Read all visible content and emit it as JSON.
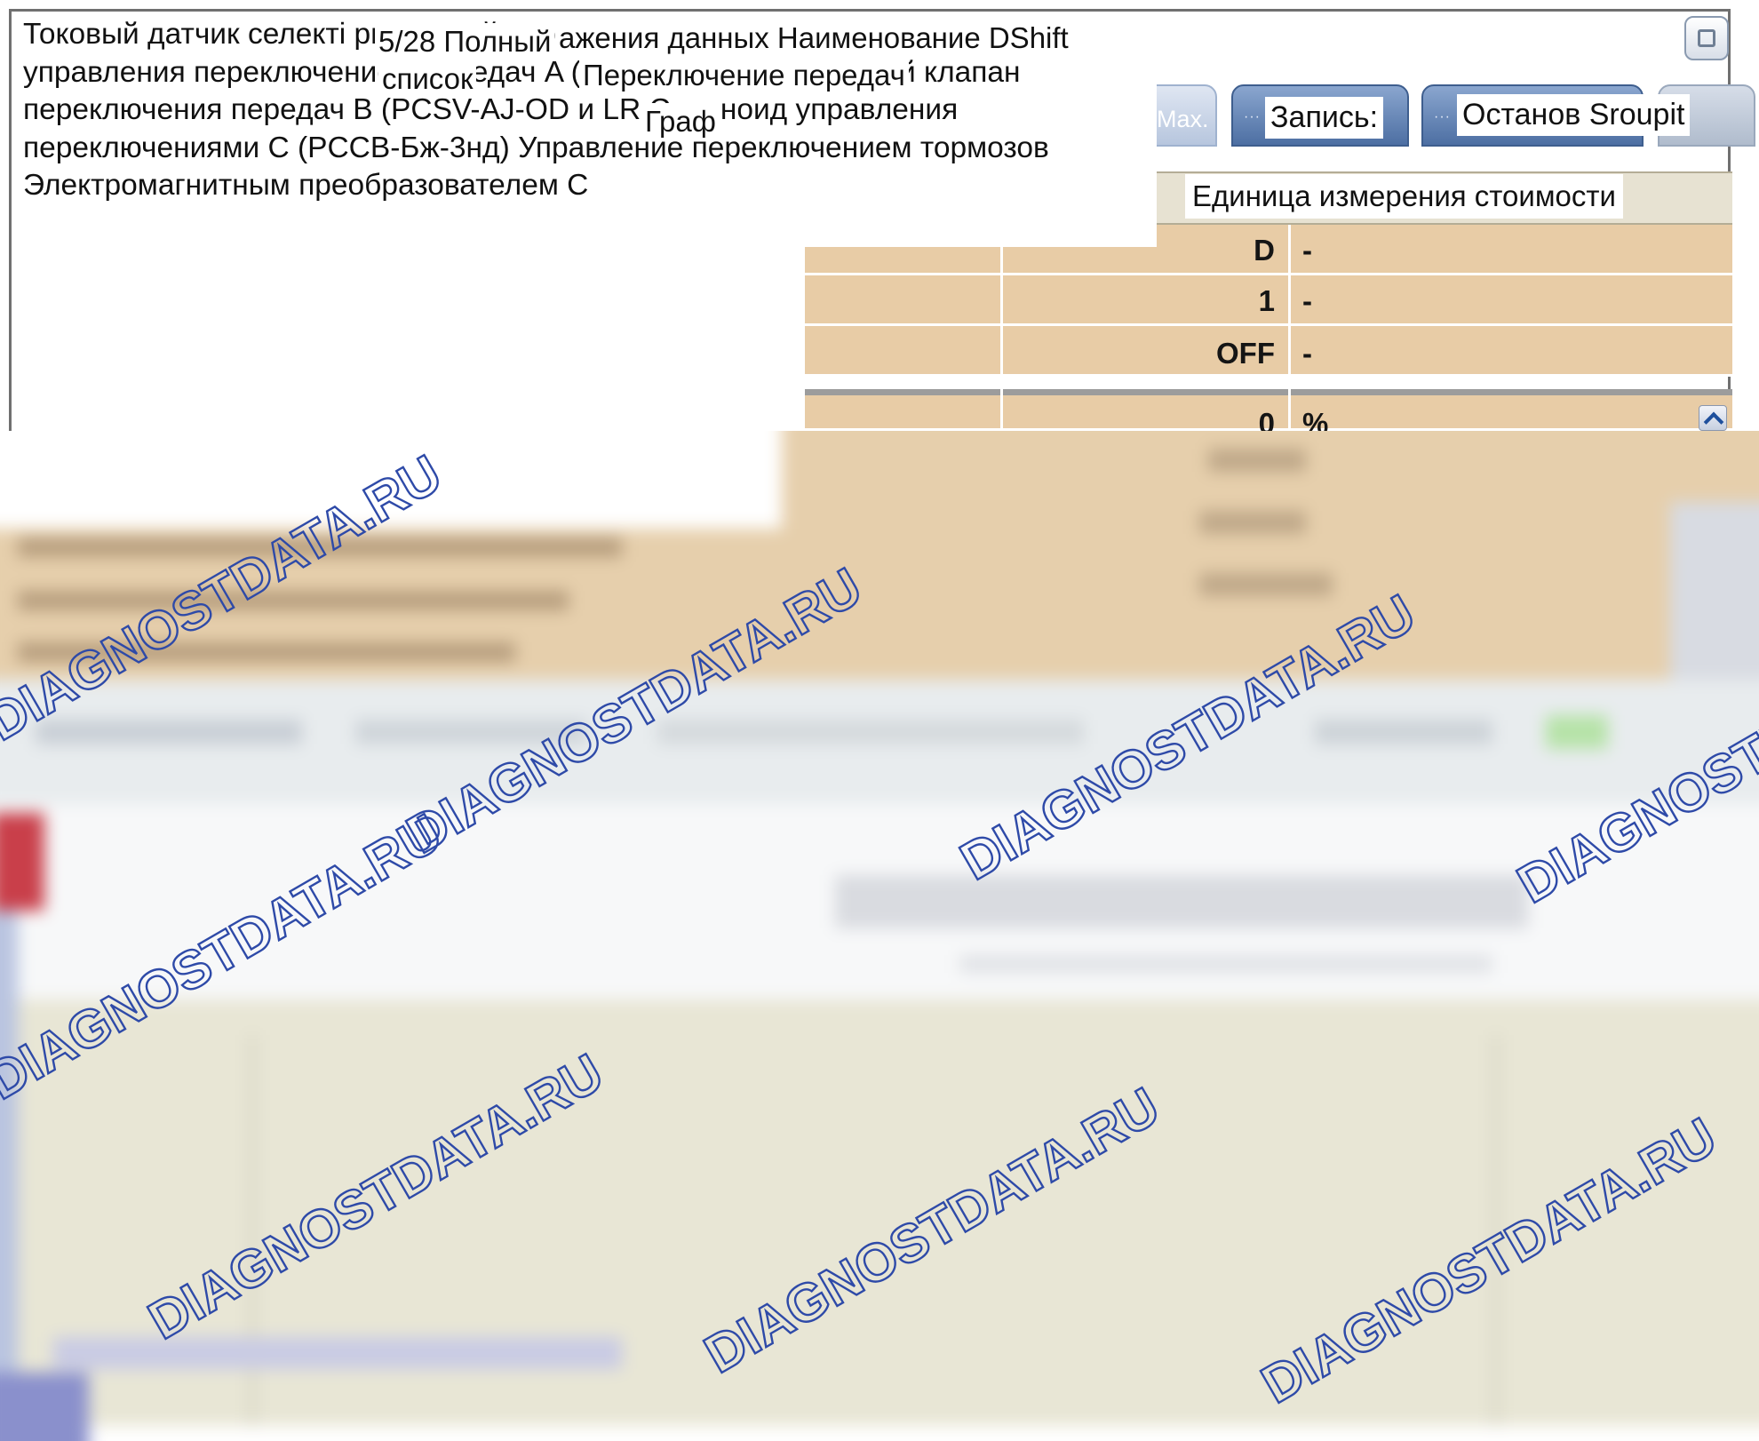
{
  "popup": {
    "description": "Токовый датчик селекті рычажный переключате Электромагнитный клапан управления переключением передач A (ONPOFF) Соленоидный клапан переключения передач B (PCSV-AJ-OD и LR Соленоид управления переключениями C (PCCB-Бж-3нд) Управление переключением тормозов Электромагнитным преобразователем C",
    "counter": "5/28 Полный",
    "list_label": "список",
    "display_header": "ажения данных Наименование DShift",
    "shift_label": "Переключение передач",
    "graph_label": "Граф"
  },
  "tabs": {
    "max_label": "Max.",
    "record_label": "Запись:",
    "stop_label": "Останов Sroupit"
  },
  "table": {
    "unit_header": "Единица измерения стоимости",
    "rows": [
      {
        "value": "D",
        "unit": "-"
      },
      {
        "value": "1",
        "unit": "-"
      },
      {
        "value": "OFF",
        "unit": "-"
      },
      {
        "value": "0",
        "unit": "%"
      }
    ]
  },
  "watermark": "DIAGNOSTDATA.RU",
  "colors": {
    "tab_blue": "#4d6fa3",
    "row_tan": "#e8cca6",
    "header_beige": "#e7e2d2",
    "watermark_blue": "#2e4aa8"
  }
}
